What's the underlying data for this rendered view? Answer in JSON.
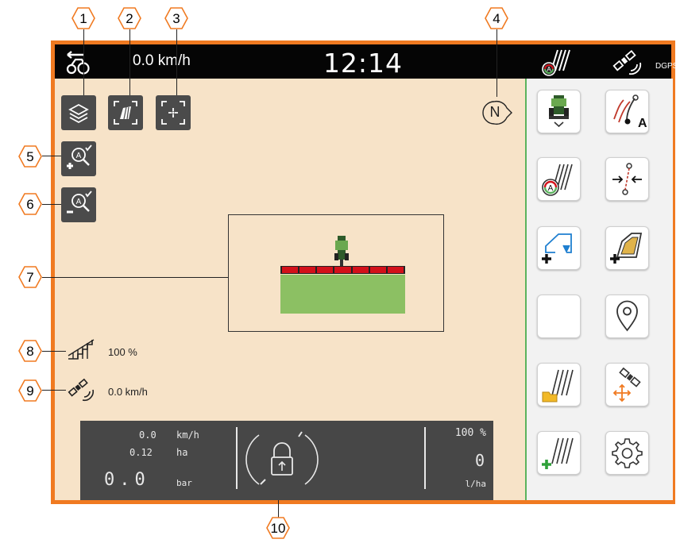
{
  "callouts": [
    "1",
    "2",
    "3",
    "4",
    "5",
    "6",
    "7",
    "8",
    "9",
    "10"
  ],
  "topbar": {
    "speed": "0.0 km/h",
    "clock": "12:14",
    "gps_mode": "DGPS"
  },
  "map": {
    "compass": "N",
    "tractor_icon": "tractor-icon",
    "boom_sections": 7
  },
  "status": {
    "coverage_percent": "100 %",
    "gps_speed": "0.0 km/h"
  },
  "dashboard": {
    "speed_value": "0.0",
    "speed_unit": "km/h",
    "area_value": "0.12",
    "area_unit": "ha",
    "pressure_value": "0.0",
    "pressure_unit": "bar",
    "rate_percent": "100 %",
    "rate_value": "0",
    "rate_unit": "l/ha"
  },
  "colors": {
    "frame": "#f07a21",
    "map_background": "#f7e3c8",
    "field": "#8cc063",
    "boom": "#d3111a",
    "panel_accent": "#5bb35d"
  }
}
